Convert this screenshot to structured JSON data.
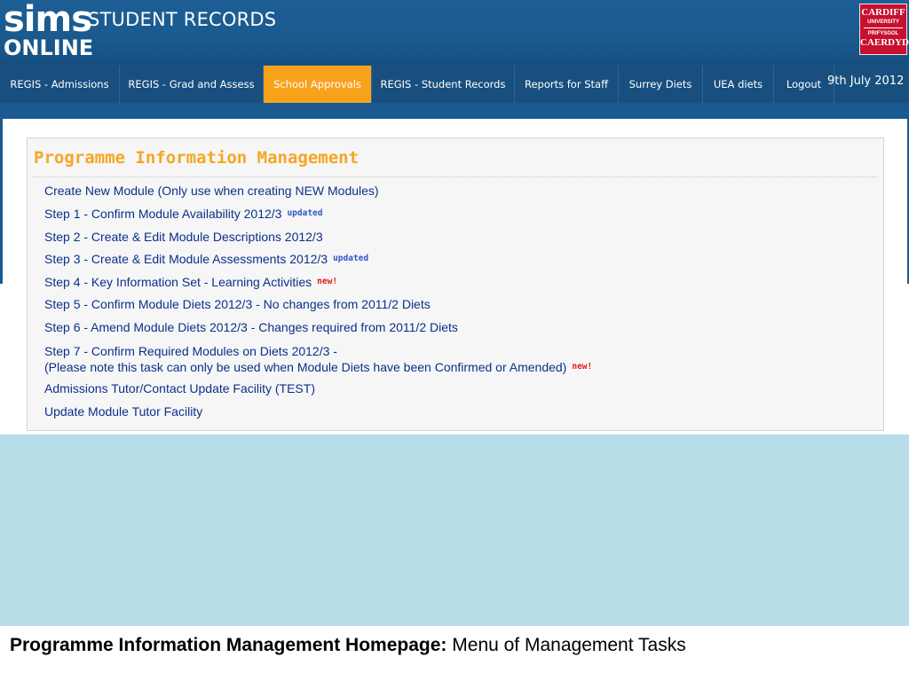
{
  "header": {
    "logo_line1": "sims",
    "logo_line2": "ONLINE",
    "app_title": "STUDENT RECORDS",
    "university_badge": {
      "line1": "CARDIFF",
      "line2": "UNIVERSITY",
      "line3": "PRIFYSGOL",
      "line4": "CAERDYD",
      "colors": {
        "background": "#c8102e",
        "text": "#ffffff"
      }
    }
  },
  "nav": {
    "items": [
      {
        "label": "REGIS - Admissions",
        "active": false
      },
      {
        "label": "REGIS - Grad and Assess",
        "active": false
      },
      {
        "label": "School Approvals",
        "active": true
      },
      {
        "label": "REGIS - Student Records",
        "active": false
      },
      {
        "label": "Reports for Staff",
        "active": false
      },
      {
        "label": "Surrey Diets",
        "active": false
      },
      {
        "label": "UEA diets",
        "active": false
      },
      {
        "label": "Logout",
        "active": false
      }
    ],
    "date": "9th July 2012",
    "colors": {
      "bar": "#184f7e",
      "active": "#f8a21c",
      "text": "#ffffff"
    }
  },
  "panel": {
    "title": "Programme Information Management",
    "items": [
      {
        "text": "Create New Module (Only use when creating NEW Modules)",
        "tag": ""
      },
      {
        "text": "Step 1 - Confirm Module Availability 2012/3",
        "tag": "updated"
      },
      {
        "text": "Step 2 - Create & Edit Module Descriptions 2012/3",
        "tag": ""
      },
      {
        "text": "Step 3 - Create & Edit Module Assessments 2012/3",
        "tag": "updated"
      },
      {
        "text": "Step 4 - Key Information Set - Learning Activities",
        "tag": "new!"
      },
      {
        "text": "Step 5 - Confirm Module Diets 2012/3 - No changes from 2011/2 Diets",
        "tag": ""
      },
      {
        "text": "Step 6 - Amend Module Diets 2012/3 - Changes required from 2011/2 Diets",
        "tag": ""
      },
      {
        "text": "Step 7 - Confirm Required Modules on Diets 2012/3 -",
        "text2": "(Please note this task can only be used when Module Diets have been Confirmed or Amended)",
        "tag": "new!"
      },
      {
        "text": "Admissions Tutor/Contact Update Facility (TEST)",
        "tag": ""
      },
      {
        "text": "Update Module Tutor Facility",
        "tag": ""
      }
    ],
    "colors": {
      "title": "#f5a623",
      "link": "#0b2f8a",
      "updated_tag": "#2f55c8",
      "new_tag": "#e31b1b"
    }
  },
  "caption": {
    "bold": "Programme Information Management Homepage:",
    "rest": "Menu of Management Tasks"
  }
}
